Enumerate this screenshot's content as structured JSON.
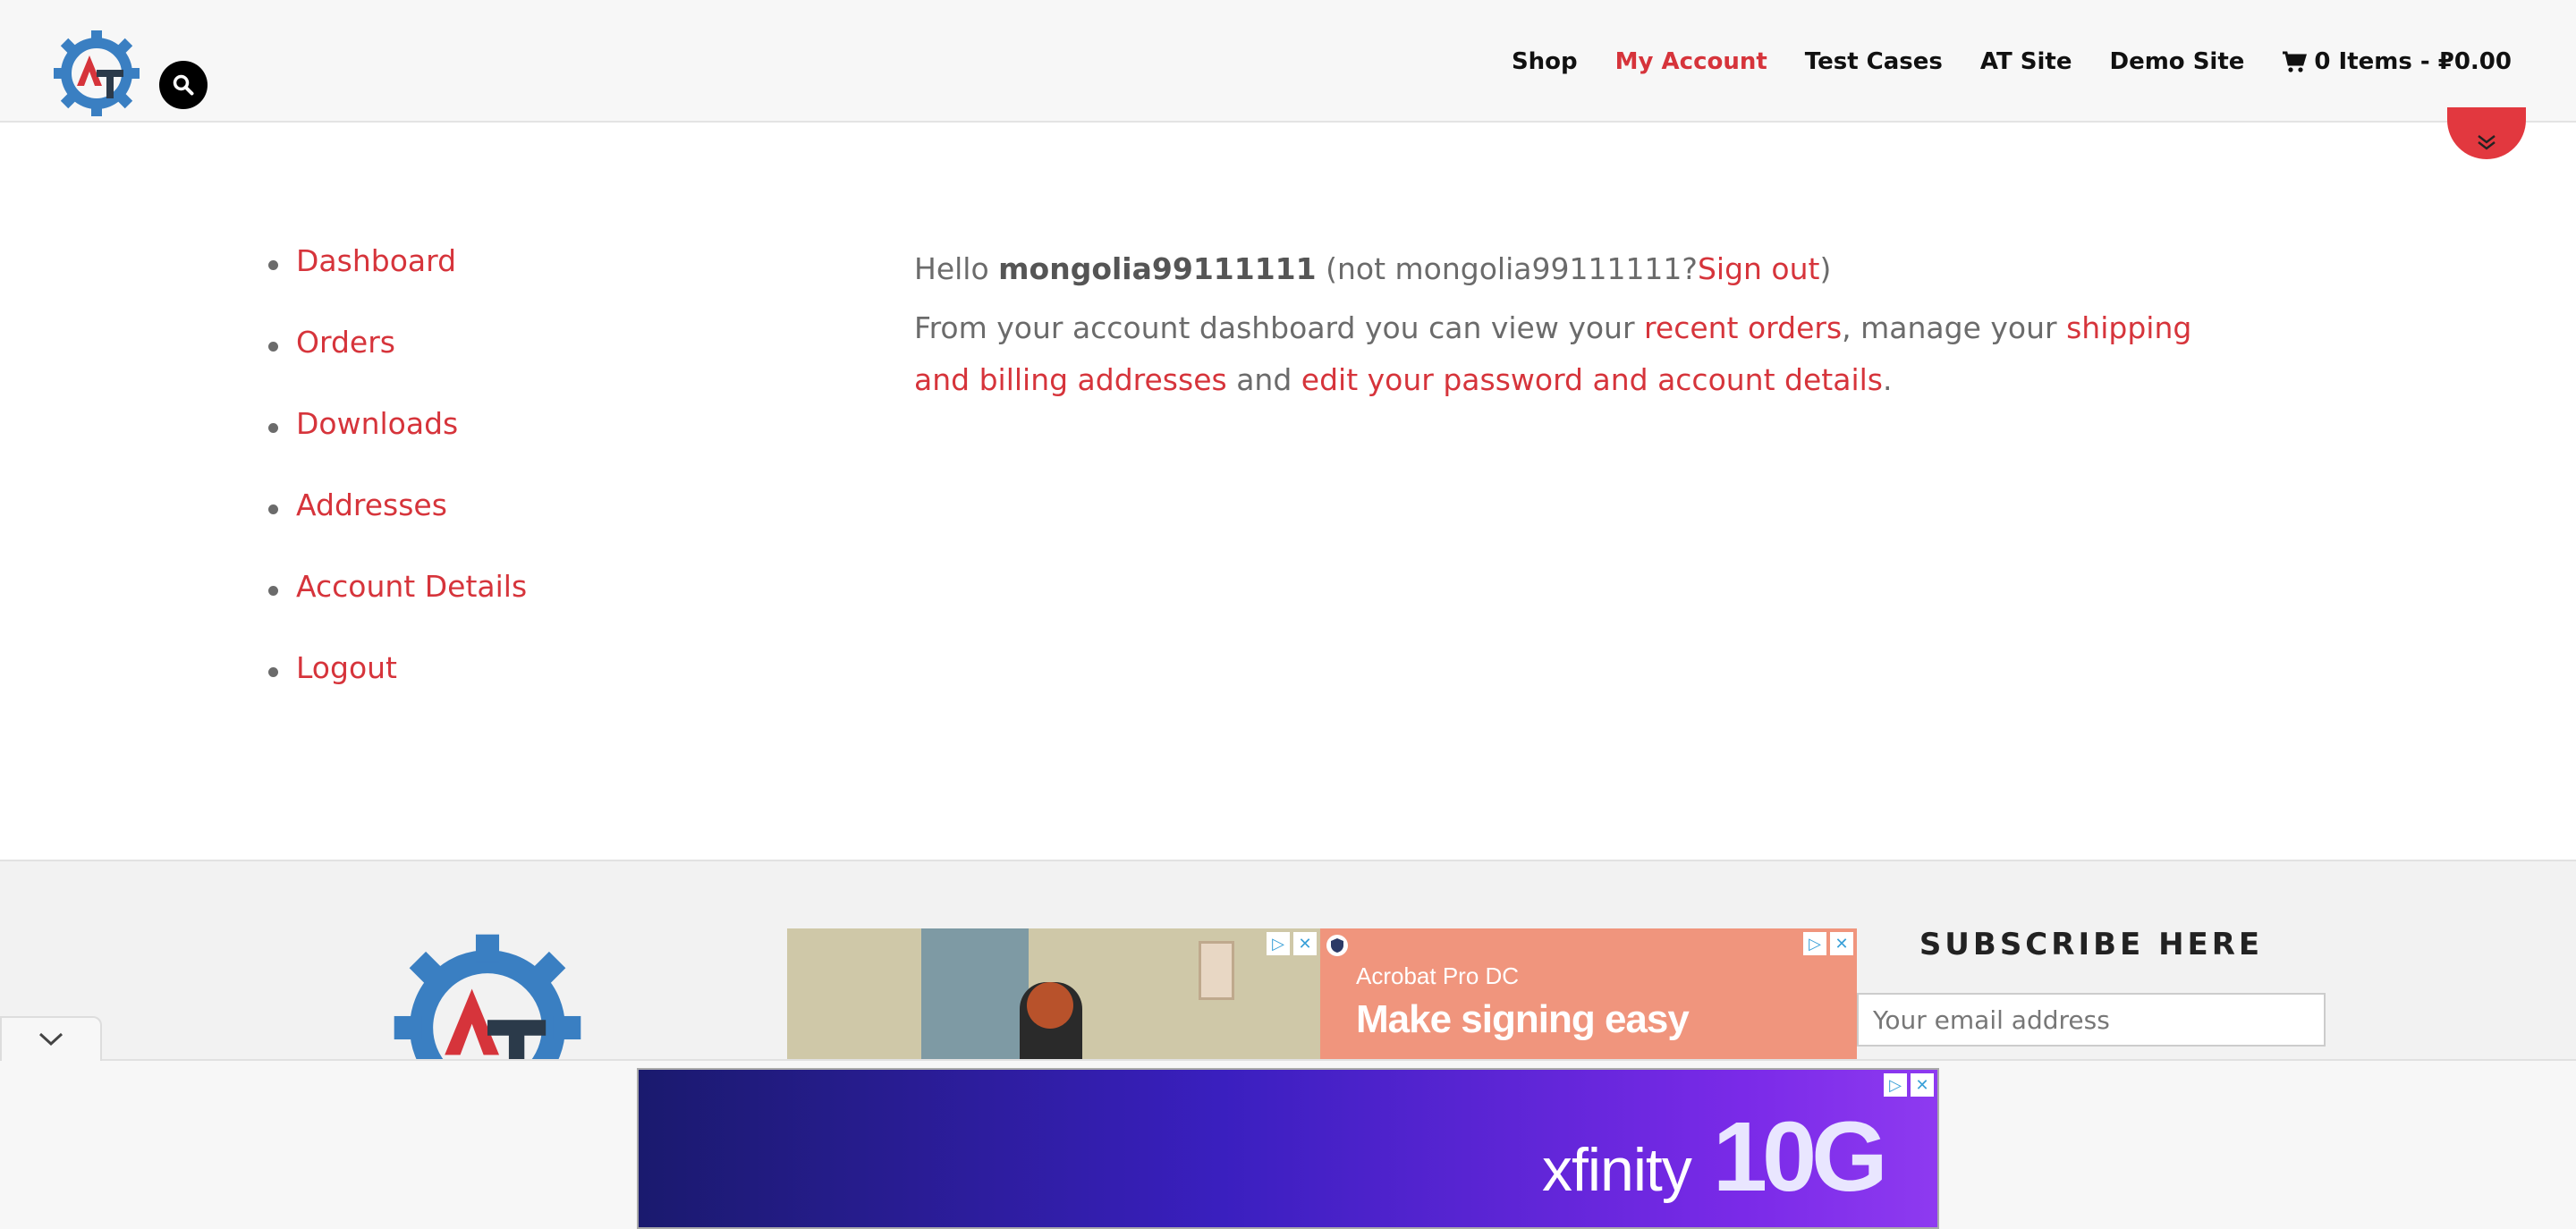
{
  "header": {
    "nav": [
      {
        "label": "Shop",
        "active": false
      },
      {
        "label": "My Account",
        "active": true
      },
      {
        "label": "Test Cases",
        "active": false
      },
      {
        "label": "AT Site",
        "active": false
      },
      {
        "label": "Demo Site",
        "active": false
      }
    ],
    "cart_label": "0 Items - ₽0.00"
  },
  "account_nav": [
    "Dashboard",
    "Orders",
    "Downloads",
    "Addresses",
    "Account Details",
    "Logout"
  ],
  "dashboard": {
    "hello_prefix": "Hello",
    "username": "mongolia99111111",
    "not_prefix": "(not",
    "not_username": "mongolia99111111?",
    "sign_out": "Sign out",
    "not_suffix": ")",
    "intro_1": "From your account dashboard you can view your",
    "recent_orders": "recent orders",
    "intro_2": ", manage your",
    "addresses_link": "shipping and billing addresses",
    "intro_3": "and",
    "account_link": "edit your password and account details",
    "intro_4": "."
  },
  "footer": {
    "subscribe_heading": "SUBSCRIBE HERE",
    "email_placeholder": "Your email address"
  },
  "ads": {
    "acrobat_small": "Acrobat Pro DC",
    "acrobat_big": "Make signing easy",
    "xfinity_name": "xfinity",
    "xfinity_speed": "10G"
  },
  "colors": {
    "accent": "#d6343b",
    "header_bg": "#f7f7f7",
    "footer_bg": "#f2f2f2"
  }
}
